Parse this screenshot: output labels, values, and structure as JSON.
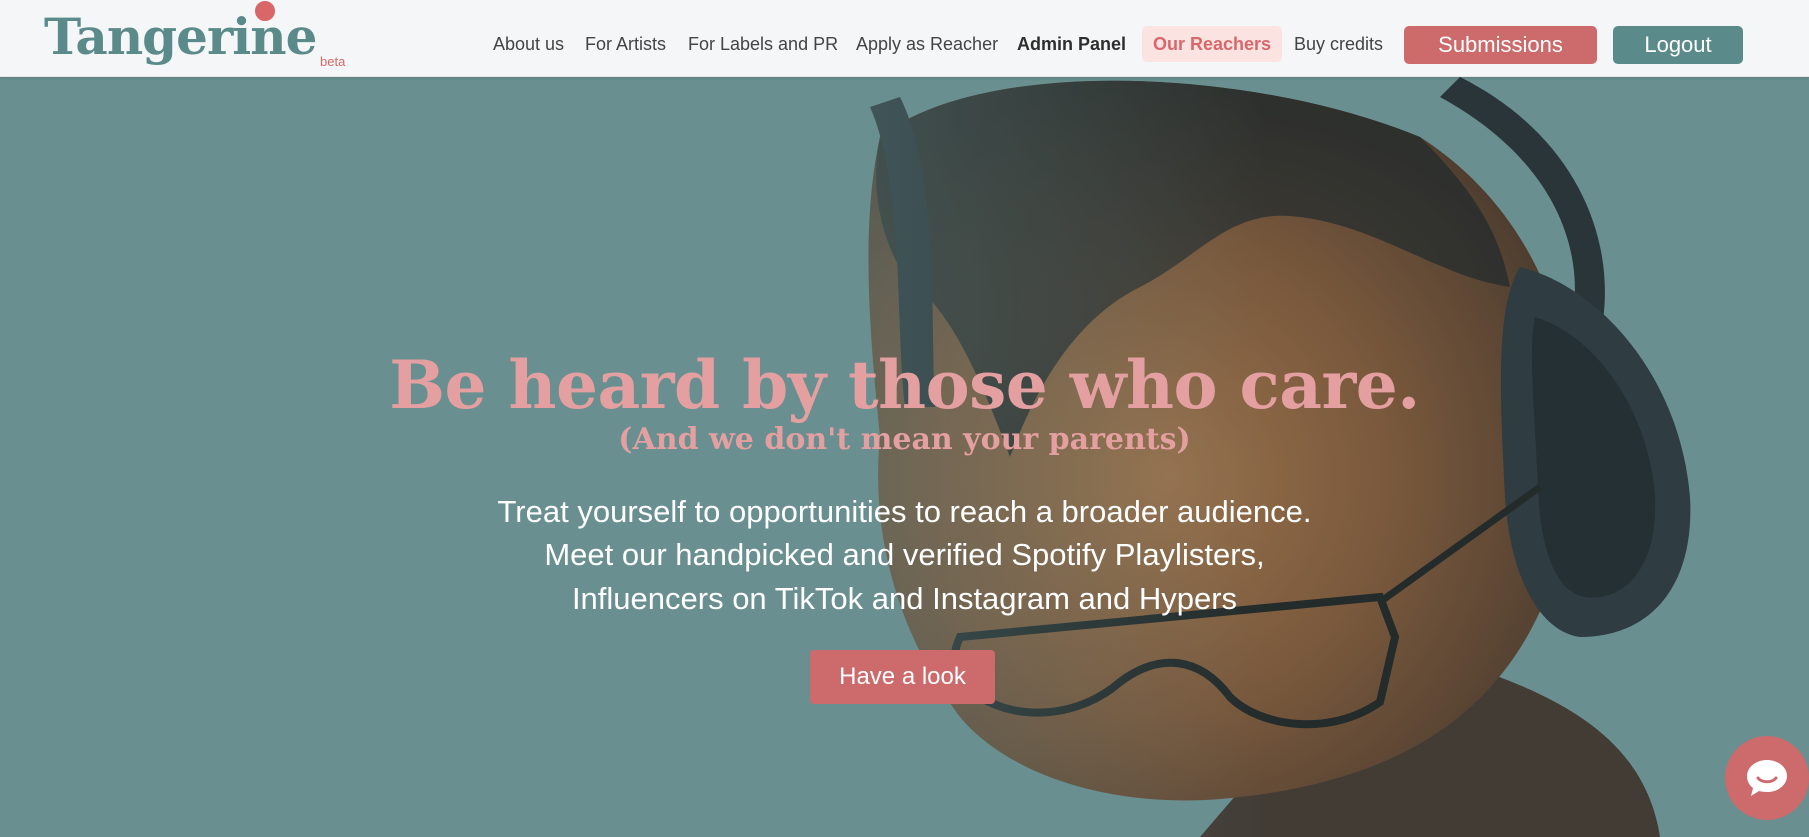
{
  "brand": {
    "name": "Tangerine",
    "tag": "beta"
  },
  "nav": {
    "items": [
      {
        "label": "About us"
      },
      {
        "label": "For Artists"
      },
      {
        "label": "For Labels and PR"
      },
      {
        "label": "Apply as Reacher"
      },
      {
        "label": "Admin Panel"
      },
      {
        "label": "Our Reachers"
      },
      {
        "label": "Buy credits"
      }
    ],
    "submissions_label": "Submissions",
    "logout_label": "Logout"
  },
  "hero": {
    "headline": "Be heard by those who care.",
    "subheadline": "(And we don't mean your parents)",
    "body": [
      "Treat yourself to opportunities to reach a broader audience.",
      "Meet our handpicked and verified Spotify Playlisters,",
      "Influencers on TikTok and Instagram and Hypers"
    ],
    "cta_label": "Have a look"
  },
  "colors": {
    "teal": "#5a8a8a",
    "hero_bg": "#6a8f90",
    "coral": "#cc6a6c",
    "pink_text": "#e4a0a0",
    "active_nav_bg": "#fbe3e1"
  },
  "icons": {
    "chat": "chat-bubble-icon"
  }
}
